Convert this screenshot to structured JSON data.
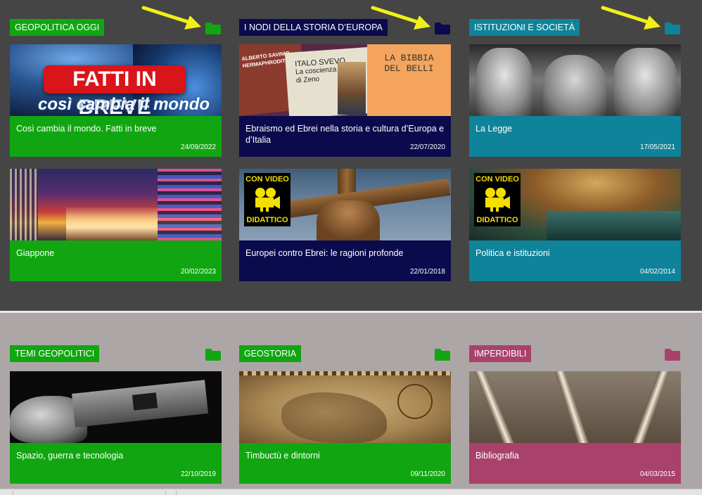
{
  "colors": {
    "green": "#11a611",
    "navy": "#0b0a4d",
    "teal": "#0e8399",
    "magenta": "#a8426b",
    "arrow": "#f0f018"
  },
  "sections": [
    {
      "tag": "GEOPOLITICA OGGI",
      "icon": "folder-icon",
      "cards": [
        {
          "title": "Così cambia il mondo. Fatti in breve",
          "date": "24/09/2022",
          "image_text": [
            "FATTI IN BREVE",
            "così cambia il mondo"
          ]
        },
        {
          "title": "Giappone",
          "date": "20/02/2023"
        }
      ]
    },
    {
      "tag": "I NODI DELLA STORIA D’EUROPA",
      "icon": "folder-icon",
      "cards": [
        {
          "title": "Ebraismo ed Ebrei nella storia e cultura d’Europa e d’Italia",
          "date": "22/07/2020",
          "image_text": [
            "ALBERTO SAVINIO",
            "HERMAPHRODITO",
            "ITALO SVEVO",
            "La coscienza di Zeno",
            "LA BIBBIA",
            "DEL BELLI"
          ]
        },
        {
          "title": "Europei contro Ebrei: le ragioni profonde",
          "date": "22/01/2018",
          "badge": [
            "CON VIDEO",
            "DIDATTICO"
          ]
        }
      ]
    },
    {
      "tag": "ISTITUZIONI E SOCIETÀ",
      "icon": "folder-icon",
      "cards": [
        {
          "title": "La Legge",
          "date": "17/05/2021"
        },
        {
          "title": "Politica e istituzioni",
          "date": "04/02/2014",
          "badge": [
            "CON VIDEO",
            "DIDATTICO"
          ]
        }
      ]
    },
    {
      "tag": "TEMI GEOPOLITICI",
      "icon": "folder-icon",
      "cards": [
        {
          "title": "Spazio, guerra e tecnologia",
          "date": "22/10/2019"
        }
      ]
    },
    {
      "tag": "GEOSTORIA",
      "icon": "folder-icon",
      "cards": [
        {
          "title": "Timbuctù e dintorni",
          "date": "09/11/2020"
        }
      ]
    },
    {
      "tag": "IMPERDIBILI",
      "icon": "folder-icon",
      "cards": [
        {
          "title": "Bibliografia",
          "date": "04/03/2015"
        }
      ]
    }
  ]
}
